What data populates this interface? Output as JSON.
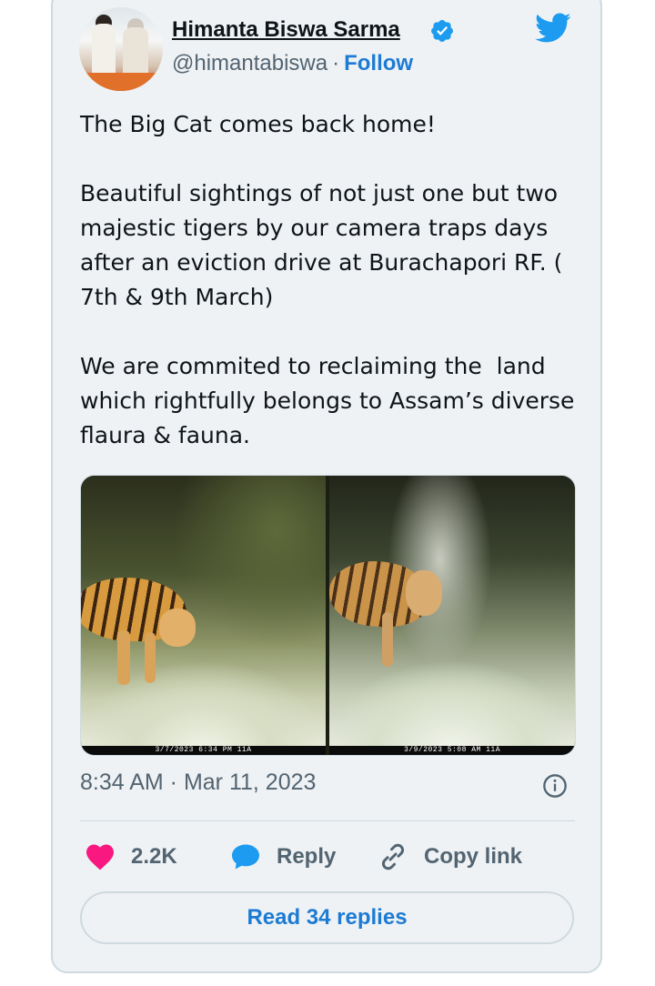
{
  "tweet": {
    "author": {
      "name": "Himanta Biswa Sarma",
      "handle": "@himantabiswa",
      "separator": "·",
      "follow_label": "Follow",
      "verified": true
    },
    "text": "The Big Cat comes back home!\n\nBeautiful sightings of not just one but two majestic tigers by our camera traps days after an eviction drive at Burachapori RF. ( 7th & 9th March)\n\nWe are commited to reclaiming the  land which rightfully belongs to Assam’s diverse flaura & fauna.",
    "media": [
      {
        "stamp": "3/7/2023    6:34 PM    11A"
      },
      {
        "stamp": "3/9/2023    5:08 AM    11A"
      }
    ],
    "timestamp": "8:34 AM · Mar 11, 2023",
    "actions": {
      "likes": "2.2K",
      "reply_label": "Reply",
      "copy_link_label": "Copy link"
    },
    "read_replies_label": "Read 34 replies"
  },
  "colors": {
    "accent": "#1d7bd3",
    "like": "#f91880",
    "twitter_blue": "#1d9bf0",
    "background": "#eef2f5"
  },
  "icons": [
    "twitter-bird-icon",
    "verified-badge-icon",
    "info-icon",
    "heart-icon",
    "reply-bubble-icon",
    "link-icon"
  ]
}
